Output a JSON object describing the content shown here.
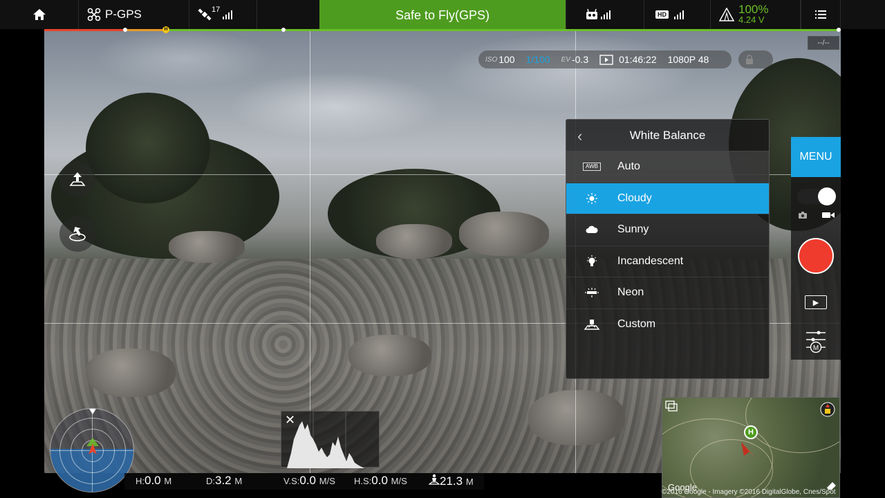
{
  "topbar": {
    "mode": "P-GPS",
    "satellites": "17",
    "status": "Safe to Fly(GPS)",
    "battery_percent": "100%",
    "battery_voltage": "4.24 V",
    "hd_label": "HD",
    "icons": [
      "home-icon",
      "drone-icon",
      "satellite-icon",
      "remote-controller-icon",
      "hd-signal-icon",
      "battery-icon",
      "menu-list-icon"
    ]
  },
  "camera_params": {
    "iso_label": "ISO",
    "iso": "100",
    "shutter": "1/100",
    "ev_label": "EV",
    "ev": "-0.3",
    "time": "01:46:22",
    "resolution": "1080P 48",
    "ev_bracket": "--/--"
  },
  "white_balance": {
    "title": "White Balance",
    "awb_badge": "AWB",
    "options": [
      {
        "label": "Auto",
        "icon": "awb-icon",
        "state": "highlight"
      },
      {
        "label": "Cloudy",
        "icon": "sun-icon",
        "state": "selected"
      },
      {
        "label": "Sunny",
        "icon": "cloud-icon",
        "state": ""
      },
      {
        "label": "Incandescent",
        "icon": "bulb-icon",
        "state": ""
      },
      {
        "label": "Neon",
        "icon": "neon-icon",
        "state": ""
      },
      {
        "label": "Custom",
        "icon": "custom-icon",
        "state": ""
      }
    ]
  },
  "right_panel": {
    "menu": "MENU",
    "mode_letter": "M"
  },
  "telemetry": {
    "h_label": "H:",
    "h_value": "0.0",
    "h_unit": "M",
    "d_label": "D:",
    "d_value": "3.2",
    "d_unit": "M",
    "vs_label": "V.S:",
    "vs_value": "0.0",
    "vs_unit": "M/S",
    "hs_label": "H.S:",
    "hs_value": "0.0",
    "hs_unit": "M/S",
    "dist_value": "21.3",
    "dist_unit": "M"
  },
  "map": {
    "credit": "©2016 Google - Imagery ©2016 DigitalGlobe, Cnes/Spot",
    "google": "Google",
    "home_marker": "H"
  },
  "colors": {
    "accent": "#1aa3e3",
    "safe": "#4e9c1f",
    "record": "#ef3b2d",
    "battery": "#6abf26"
  }
}
